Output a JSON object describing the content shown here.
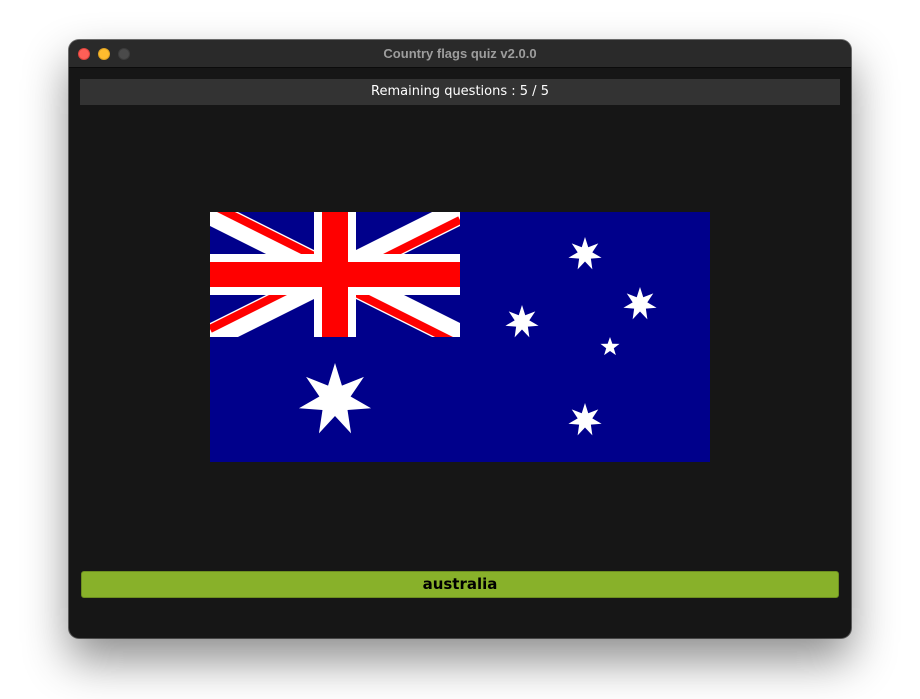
{
  "window": {
    "title": "Country flags quiz v2.0.0"
  },
  "quiz": {
    "remaining_label": "Remaining questions : 5 / 5",
    "remaining": 5,
    "total": 5
  },
  "flag": {
    "icon": "australia-flag",
    "colors": {
      "field": "#00008b",
      "cross": "#ff0000",
      "white": "#ffffff"
    }
  },
  "answers": [
    {
      "label": "australia"
    }
  ],
  "colors": {
    "window_bg": "#161616",
    "status_bg": "#333333",
    "answer_button": "#88b12a"
  }
}
